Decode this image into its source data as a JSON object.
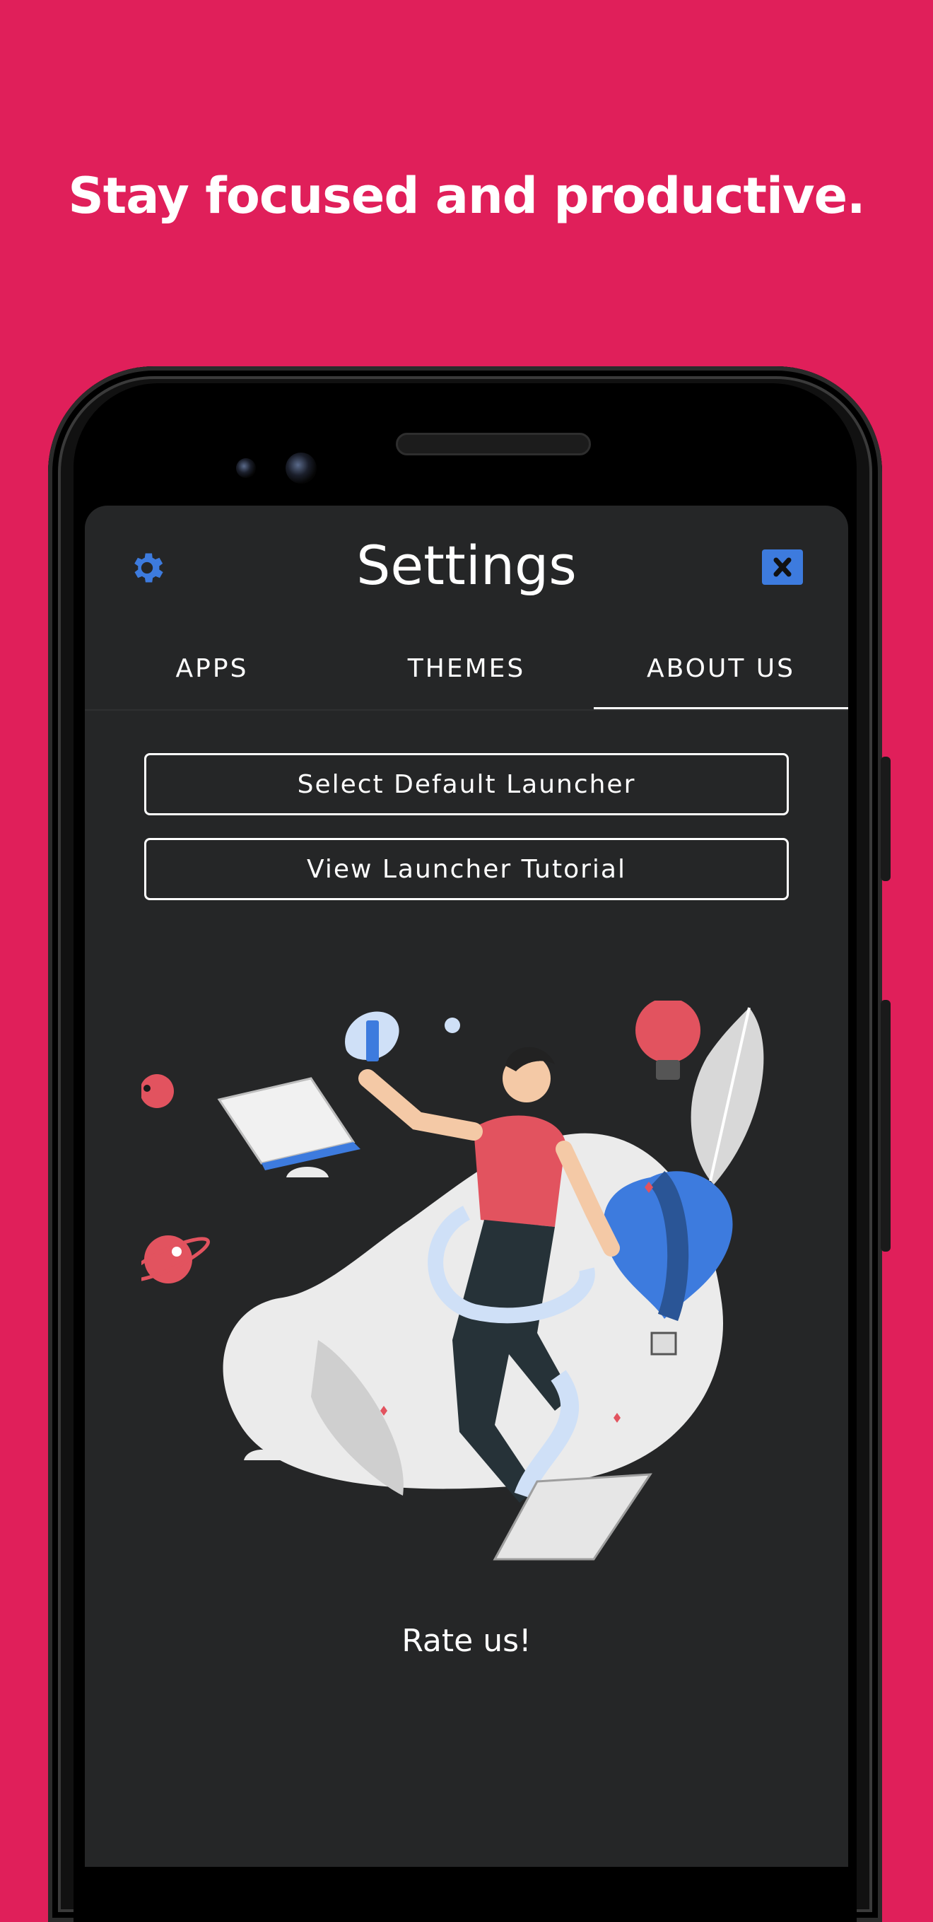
{
  "headline": "Stay focused and productive.",
  "settings": {
    "title": "Settings",
    "gear_icon": "gear-icon",
    "close_icon": "close-icon",
    "accent_color": "#3D7BDE"
  },
  "tabs": [
    {
      "label": "APPS",
      "active": false
    },
    {
      "label": "THEMES",
      "active": false
    },
    {
      "label": "ABOUT US",
      "active": true
    }
  ],
  "about": {
    "select_launcher_label": "Select Default Launcher",
    "tutorial_label": "View Launcher Tutorial",
    "rate_label": "Rate us!"
  },
  "colors": {
    "background": "#E01F5A",
    "screen": "#252627"
  }
}
